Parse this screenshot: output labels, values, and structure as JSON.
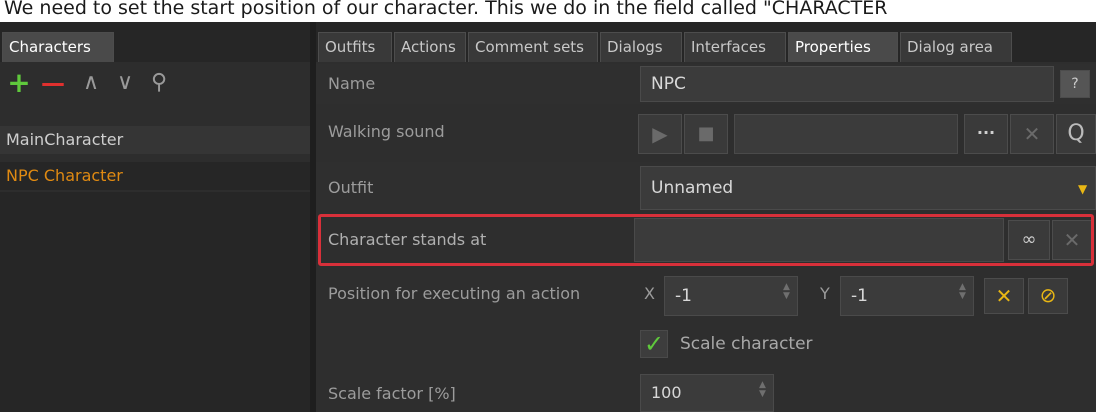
{
  "caption": "We need to set the start position of our character. This we do in the field called \"CHARACTER",
  "left": {
    "tab_label": "Characters",
    "toolbar": {
      "add": "+",
      "remove": "—",
      "up": "∧",
      "down": "∨",
      "search": "⚲"
    },
    "characters": [
      "MainCharacter",
      "NPC Character"
    ]
  },
  "right": {
    "tabs": [
      "Outfits",
      "Actions",
      "Comment sets",
      "Dialogs",
      "Interfaces",
      "Properties",
      "Dialog area"
    ],
    "active_tab": "Properties",
    "properties": {
      "name_label": "Name",
      "name_value": "NPC",
      "name_help": "?",
      "walking_sound_label": "Walking sound",
      "walking_sound_value": "",
      "more_button": "···",
      "clear_button": "✕",
      "search_button": "Q",
      "outfit_label": "Outfit",
      "outfit_value": "Unnamed",
      "stands_at_label": "Character stands at",
      "stands_at_value": "",
      "position_label": "Position for executing an action",
      "x_label": "X",
      "x_value": "-1",
      "y_label": "Y",
      "y_value": "-1",
      "scale_checkbox_label": "Scale character",
      "scale_checked": true,
      "scale_factor_label": "Scale factor [%]",
      "scale_factor_value": "100"
    }
  },
  "colors": {
    "accent_orange": "#e08a12",
    "add_green": "#5fc93c",
    "remove_red": "#e0302e",
    "highlight_red": "#d8303a",
    "check_green": "#5fc93c",
    "warn_yellow": "#e9b714"
  }
}
